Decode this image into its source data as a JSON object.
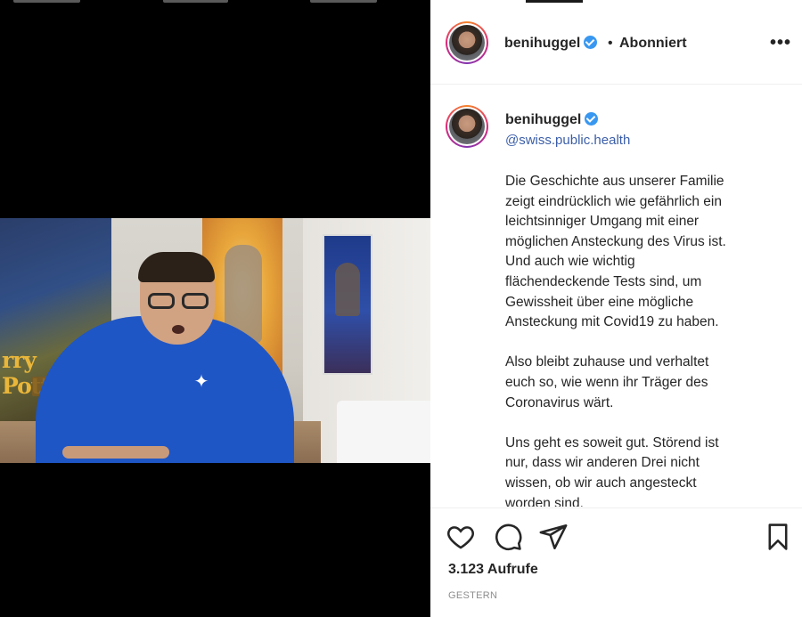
{
  "header": {
    "username": "benihuggel",
    "separator": "•",
    "follow_status": "Abonniert",
    "more_icon": "more-horizontal-icon"
  },
  "media": {
    "poster_text": "rry Potter"
  },
  "caption": {
    "username": "benihuggel",
    "mention": "@swiss.public.health",
    "paragraphs": [
      "Die Geschichte aus unserer Familie\nzeigt eindrücklich wie gefährlich ein\nleichtsinniger Umgang mit einer\nmöglichen Ansteckung des Virus ist.\nUnd auch wie wichtig\nflächendeckende Tests sind, um\nGewissheit über eine mögliche\nAnsteckung mit Covid19 zu haben.",
      "Also bleibt zuhause und verhaltet\neuch so, wie wenn ihr Träger des\nCoronavirus wärt.",
      "Uns geht es soweit gut. Störend ist\nnur, dass wir anderen Drei nicht\nwissen, ob wir auch angesteckt\nworden sind."
    ]
  },
  "actions": {
    "icons": [
      "heart-icon",
      "comment-icon",
      "share-icon",
      "bookmark-icon"
    ],
    "views": "3.123 Aufrufe",
    "timestamp": "GESTERN"
  },
  "colors": {
    "verified": "#3897f0",
    "link": "#3b5ea8",
    "text": "#262626",
    "muted": "#8e8e8e"
  }
}
